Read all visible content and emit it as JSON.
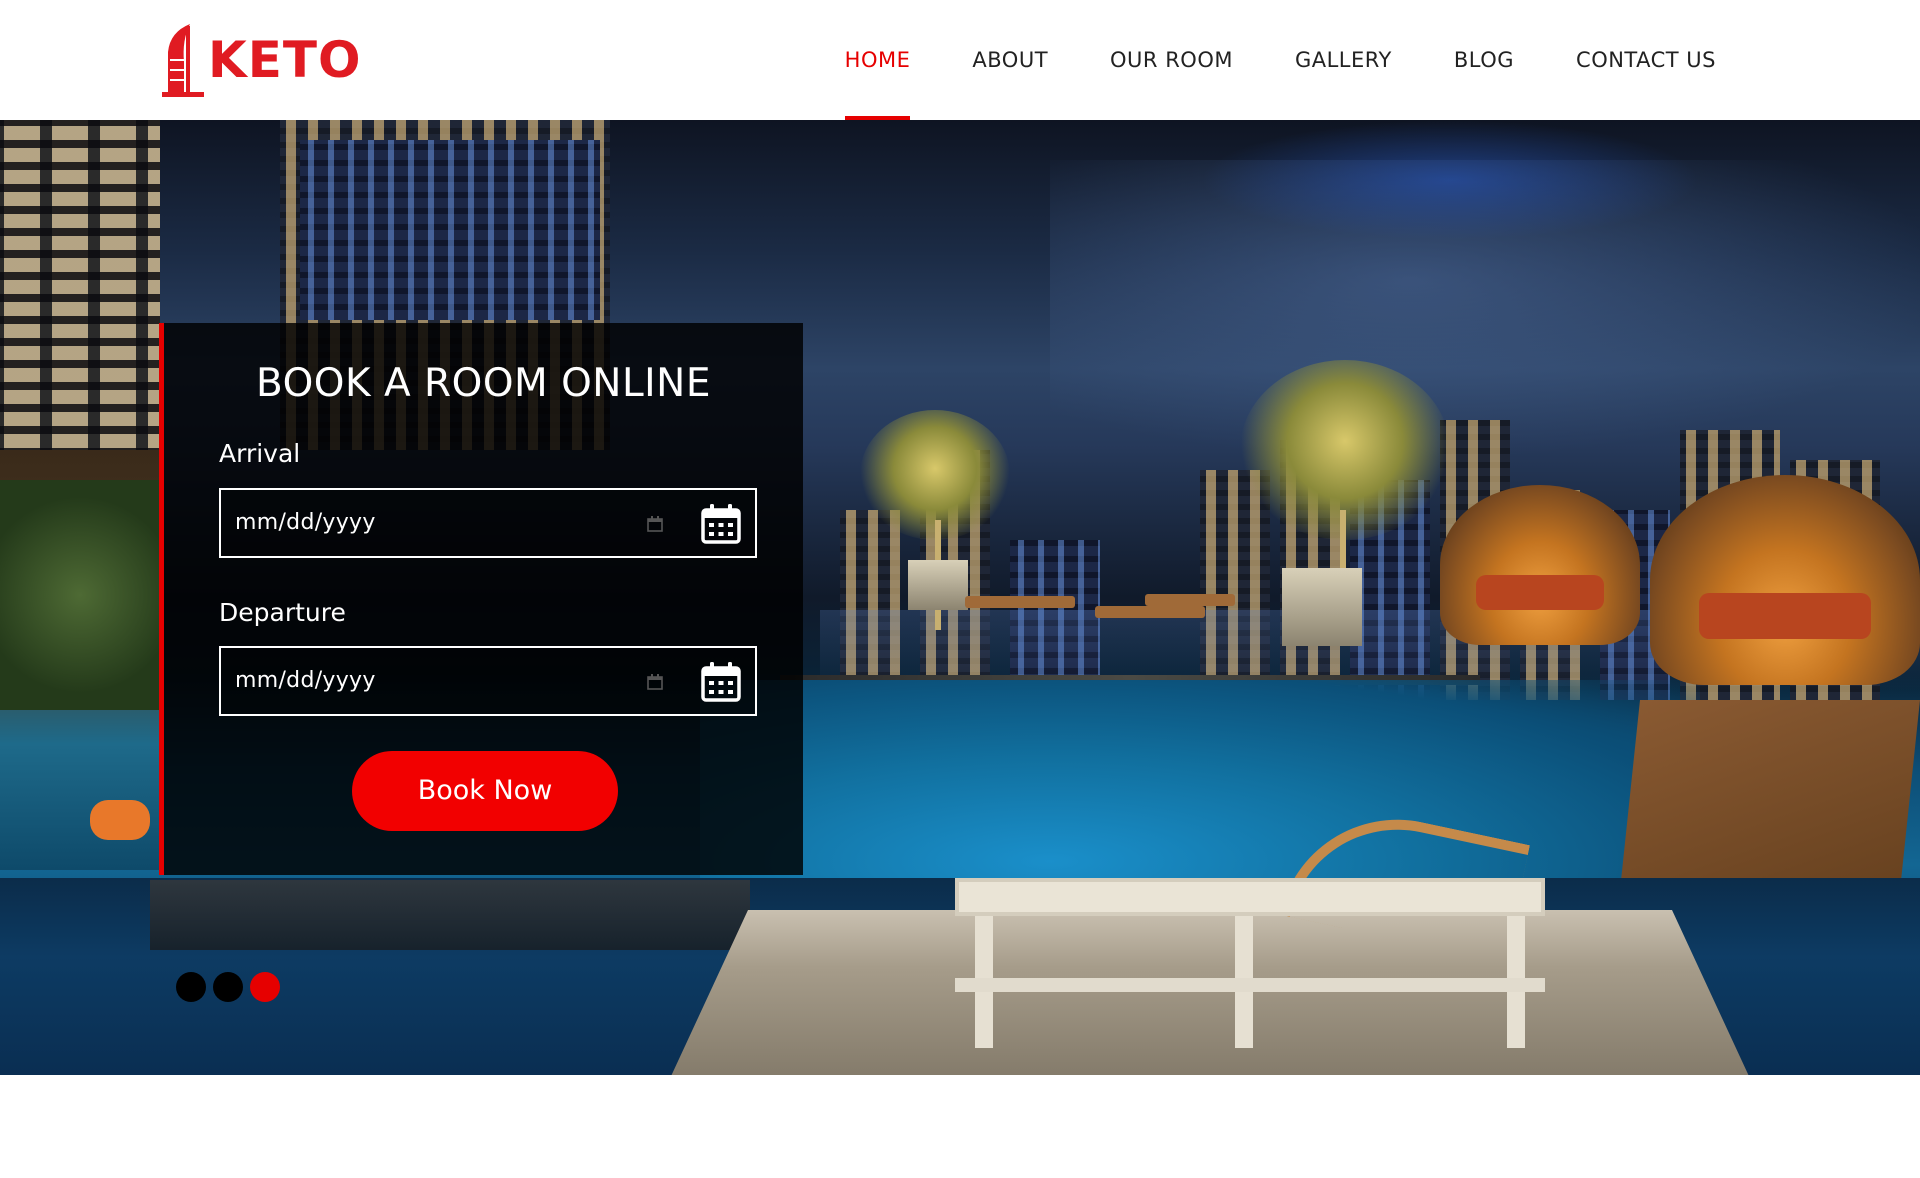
{
  "brand": {
    "name": "KETO",
    "accent_color": "#e60000",
    "logo_icon": "hotel-tower-icon"
  },
  "nav": {
    "items": [
      {
        "label": "HOME",
        "active": true
      },
      {
        "label": "ABOUT",
        "active": false
      },
      {
        "label": "OUR ROOM",
        "active": false
      },
      {
        "label": "GALLERY",
        "active": false
      },
      {
        "label": "BLOG",
        "active": false
      },
      {
        "label": "CONTACT US",
        "active": false
      }
    ]
  },
  "booking": {
    "title": "BOOK A ROOM ONLINE",
    "arrival_label": "Arrival",
    "arrival_placeholder": "mm/dd/yyyy",
    "departure_label": "Departure",
    "departure_placeholder": "mm/dd/yyyy",
    "button_label": "Book Now",
    "calendar_icon": "calendar-icon"
  },
  "carousel": {
    "dot_count": 3,
    "active_index": 2,
    "dot_color": "#000000",
    "active_dot_color": "#e60000"
  }
}
